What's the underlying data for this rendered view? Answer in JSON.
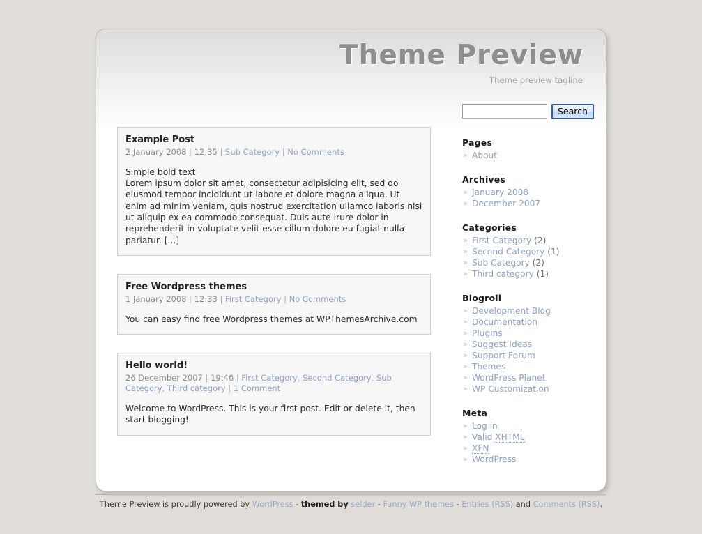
{
  "site": {
    "title": "Theme Preview",
    "tagline": "Theme preview tagline"
  },
  "search": {
    "value": "",
    "placeholder": "",
    "button_label": "Search"
  },
  "posts": [
    {
      "title": "Example Post",
      "date": "2 January 2008",
      "time": "12:35",
      "categories": [
        "Sub Category"
      ],
      "comments": "No Comments",
      "body_line1": "Simple bold text",
      "body_line2": "Lorem ipsum dolor sit amet, consectetur adipisicing elit, sed do eiusmod tempor incididunt ut labore et dolore magna aliqua. Ut enim ad minim veniam, quis nostrud exercitation ullamco laboris nisi ut aliquip ex ea commodo consequat. Duis aute irure dolor in reprehenderit in voluptate velit esse cillum dolore eu fugiat nulla pariatur. [...]"
    },
    {
      "title": "Free Wordpress themes",
      "date": "1 January 2008",
      "time": "12:33",
      "categories": [
        "First Category"
      ],
      "comments": "No Comments",
      "body_line1": "",
      "body_line2": "You can easy find free Wordpress themes at WPThemesArchive.com"
    },
    {
      "title": "Hello world!",
      "date": "26 December 2007",
      "time": "19:46",
      "categories": [
        "First Category",
        "Second Category",
        "Sub Category",
        "Third category"
      ],
      "comments": "1 Comment",
      "body_line1": "",
      "body_line2": "Welcome to WordPress. This is your first post. Edit or delete it, then start blogging!"
    }
  ],
  "sidebar": {
    "marker": "»",
    "blocks": [
      {
        "title": "Pages",
        "items": [
          {
            "label": "About",
            "count": ""
          }
        ]
      },
      {
        "title": "Archives",
        "items": [
          {
            "label": "January 2008",
            "count": ""
          },
          {
            "label": "December 2007",
            "count": ""
          }
        ]
      },
      {
        "title": "Categories",
        "items": [
          {
            "label": "First Category",
            "count": "(2)"
          },
          {
            "label": "Second Category",
            "count": "(1)"
          },
          {
            "label": "Sub Category",
            "count": "(2)"
          },
          {
            "label": "Third category",
            "count": "(1)"
          }
        ]
      },
      {
        "title": "Blogroll",
        "items": [
          {
            "label": "Development Blog",
            "count": ""
          },
          {
            "label": "Documentation",
            "count": ""
          },
          {
            "label": "Plugins",
            "count": ""
          },
          {
            "label": "Suggest Ideas",
            "count": ""
          },
          {
            "label": "Support Forum",
            "count": ""
          },
          {
            "label": "Themes",
            "count": ""
          },
          {
            "label": "WordPress Planet",
            "count": ""
          },
          {
            "label": "WP Customization",
            "count": ""
          }
        ]
      },
      {
        "title": "Meta",
        "items": [
          {
            "label": "Log in",
            "count": ""
          },
          {
            "label": "Valid XHTML",
            "count": "",
            "abbr": "XHTML"
          },
          {
            "label": "XFN",
            "count": "",
            "abbr": "XFN"
          },
          {
            "label": "WordPress",
            "count": ""
          }
        ]
      }
    ]
  },
  "footer": {
    "part1": "Theme Preview is proudly powered by",
    "link1": "WordPress",
    "dash1": "-",
    "bold1": "themed by",
    "link2": "selder",
    "dash2": "-",
    "link3": "Funny WP themes",
    "dash3": "-",
    "link4": "Entries (RSS)",
    "and": "and",
    "link5": "Comments (RSS)",
    "period": "."
  },
  "colors": {
    "background": "#e1ddd8",
    "link": "#8ea0c4",
    "title": "#8e8e8e",
    "panel": "#f7f7f7",
    "button_border": "#2f5d9e"
  }
}
